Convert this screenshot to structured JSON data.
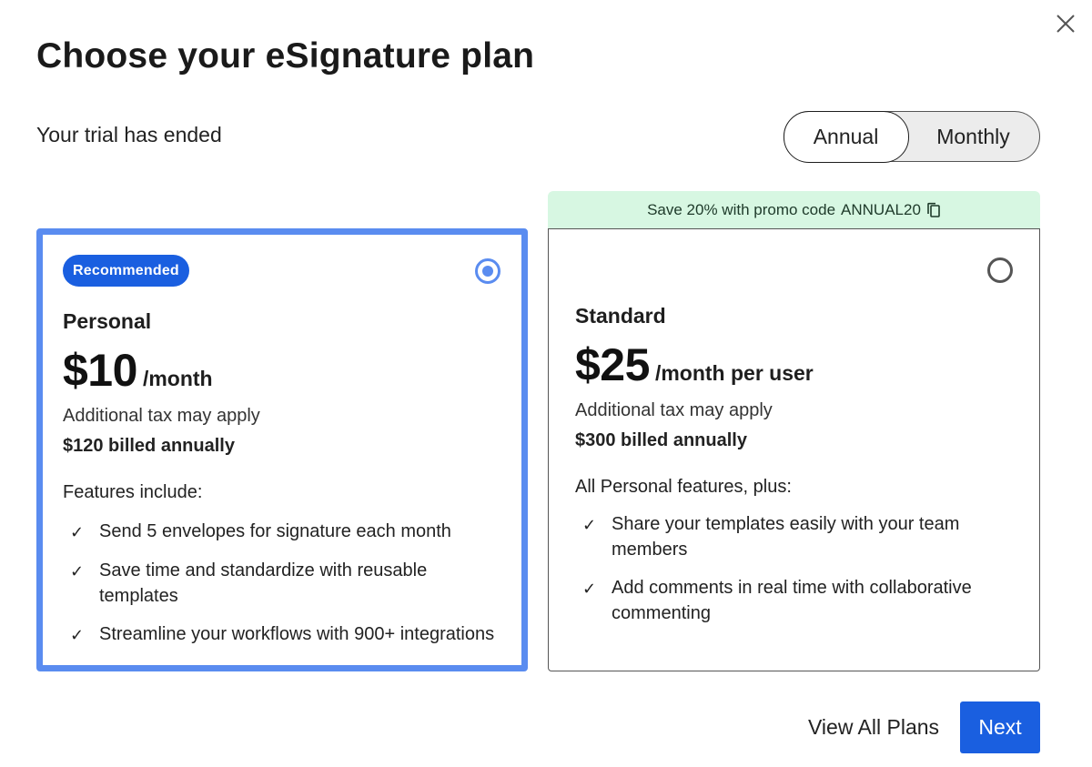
{
  "dialog": {
    "title": "Choose your eSignature plan",
    "subtitle": "Your trial has ended"
  },
  "billing_toggle": {
    "selected": "Annual",
    "options": [
      "Annual",
      "Monthly"
    ]
  },
  "promo": {
    "text": "Save 20% with promo code",
    "code": "ANNUAL20",
    "background_color": "#d7f7e2"
  },
  "plans": [
    {
      "badge": "Recommended",
      "selected": true,
      "name": "Personal",
      "price": "$10",
      "period": "/month",
      "tax_note": "Additional tax may apply",
      "billed": "$120 billed annually",
      "features_label": "Features include:",
      "features": [
        "Send 5 envelopes for signature each month",
        "Save time and standardize with reusable templates",
        "Streamline your workflows with 900+ integrations"
      ]
    },
    {
      "badge": "",
      "selected": false,
      "name": "Standard",
      "price": "$25",
      "period": "/month per user",
      "tax_note": "Additional tax may apply",
      "billed": "$300 billed annually",
      "features_label": "All Personal features, plus:",
      "features": [
        "Share your templates easily with your team members",
        "Add comments in real time with collaborative commenting"
      ]
    }
  ],
  "footer": {
    "view_all_label": "View All Plans",
    "next_label": "Next"
  },
  "icons": {
    "close": "close-icon",
    "copy": "copy-icon",
    "check": "checkmark-icon"
  },
  "colors": {
    "primary": "#1a5fe0",
    "selected_border": "#5a8cf0"
  }
}
